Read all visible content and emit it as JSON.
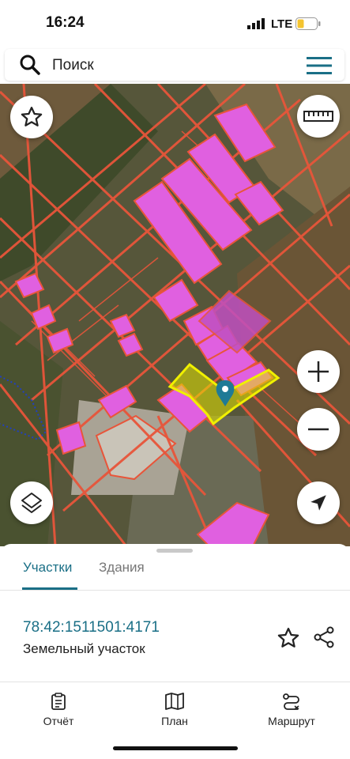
{
  "status": {
    "time": "16:24",
    "network": "LTE"
  },
  "search": {
    "placeholder": "Поиск",
    "search_icon": "search-icon",
    "menu_icon": "hamburger-menu-icon"
  },
  "map": {
    "controls": {
      "favorite_icon": "star-icon",
      "ruler_icon": "ruler-icon",
      "zoom_in_icon": "plus-icon",
      "zoom_out_icon": "minus-icon",
      "layers_icon": "layers-icon",
      "locate_icon": "navigation-arrow-icon"
    },
    "colors": {
      "parcel_border": "#e8553a",
      "building_fill": "#e060e0",
      "selected_parcel": "#f0f000",
      "pin": "#1f7a96"
    }
  },
  "sheet": {
    "tabs": [
      {
        "label": "Участки",
        "active": true
      },
      {
        "label": "Здания",
        "active": false
      }
    ],
    "parcel": {
      "cadastral_number": "78:42:1511501:4171",
      "type": "Земельный участок"
    }
  },
  "bottom_nav": [
    {
      "label": "Отчёт",
      "icon": "report-clipboard-icon"
    },
    {
      "label": "План",
      "icon": "map-book-icon"
    },
    {
      "label": "Маршрут",
      "icon": "route-icon"
    }
  ],
  "accent_color": "#1a6f86"
}
